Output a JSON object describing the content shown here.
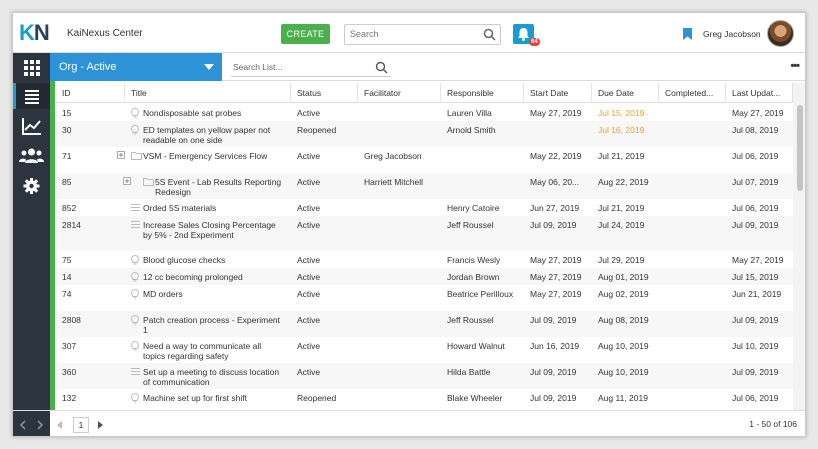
{
  "app": {
    "logo_k": "K",
    "logo_n": "N",
    "title": "KaiNexus Center"
  },
  "header": {
    "create_label": "CREATE",
    "search_placeholder": "Search",
    "notification_count": "64",
    "user_name": "Greg Jacobson"
  },
  "sidebar": {
    "items": [
      {
        "icon": "apps-grid-icon"
      },
      {
        "icon": "list-icon",
        "active": true
      },
      {
        "icon": "chart-icon"
      },
      {
        "icon": "users-icon"
      },
      {
        "icon": "gear-icon"
      }
    ]
  },
  "filter": {
    "selected": "Org - Active",
    "search_placeholder": "Search List...",
    "more_label": "•••"
  },
  "table": {
    "columns": [
      "ID",
      "Title",
      "Status",
      "Facilitator",
      "Responsible",
      "Start Date",
      "Due Date",
      "Completed...",
      "Last Updat..."
    ],
    "rows": [
      {
        "id": "15",
        "icon": "bulb",
        "title": "Nondisposable sat probes",
        "status": "Active",
        "facilitator": "",
        "responsible": "Lauren Villa",
        "start": "May 27, 2019",
        "due": "Jul 15, 2019",
        "due_overdue": true,
        "completed": "",
        "updated": "May 27, 2019"
      },
      {
        "id": "30",
        "icon": "bulb",
        "title": "ED templates on yellow paper not readable on one side",
        "status": "Reopened",
        "facilitator": "",
        "responsible": "Arnold Smith",
        "start": "",
        "due": "Jul 16, 2019",
        "due_overdue": true,
        "completed": "",
        "updated": "Jul 08, 2019"
      },
      {
        "id": "71",
        "icon": "folder",
        "expand": true,
        "title": "VSM - Emergency Services Flow",
        "status": "Active",
        "facilitator": "Greg Jacobson",
        "responsible": "",
        "start": "May 22, 2019",
        "due": "Jul 21, 2019",
        "due_overdue": false,
        "completed": "",
        "updated": "Jul 06, 2019"
      },
      {
        "id": "85",
        "icon": "folder",
        "expand": true,
        "title": "5S Event - Lab Results Reporting Redesign",
        "status": "Active",
        "facilitator": "Harriett Mitchell",
        "responsible": "",
        "start": "May 06, 20...",
        "due": "Aug 22, 2019",
        "due_overdue": false,
        "completed": "",
        "updated": "Jul 07, 2019"
      },
      {
        "id": "852",
        "icon": "list",
        "title": "Orded 5S materials",
        "status": "Active",
        "facilitator": "",
        "responsible": "Henry Catoire",
        "start": "Jun 27, 2019",
        "due": "Jul 21, 2019",
        "due_overdue": false,
        "completed": "",
        "updated": "Jul 06, 2019"
      },
      {
        "id": "2814",
        "icon": "list",
        "title": "Increase Sales Closing Percentage by 5% - 2nd Experiment",
        "status": "Active",
        "facilitator": "",
        "responsible": "Jeff Roussel",
        "start": "Jul 09, 2019",
        "due": "Jul 24, 2019",
        "due_overdue": false,
        "completed": "",
        "updated": "Jul 09, 2019"
      },
      {
        "id": "75",
        "icon": "bulb",
        "title": "Blood glucose checks",
        "status": "Active",
        "facilitator": "",
        "responsible": "Francis Wesly",
        "start": "May 27, 2019",
        "due": "Jul 29, 2019",
        "due_overdue": false,
        "completed": "",
        "updated": "May 27, 2019"
      },
      {
        "id": "14",
        "icon": "bulb",
        "title": "12 cc becoming prolonged",
        "status": "Active",
        "facilitator": "",
        "responsible": "Jordan Brown",
        "start": "May 27, 2019",
        "due": "Aug 01, 2019",
        "due_overdue": false,
        "completed": "",
        "updated": "Jul 15, 2019"
      },
      {
        "id": "74",
        "icon": "bulb",
        "title": "MD orders",
        "status": "Active",
        "facilitator": "",
        "responsible": "Beatrice Perilloux",
        "start": "May 27, 2019",
        "due": "Aug 02, 2019",
        "due_overdue": false,
        "completed": "",
        "updated": "Jun 21, 2019"
      },
      {
        "id": "2808",
        "icon": "bulb",
        "title": "Patch creation process - Experiment 1",
        "status": "Active",
        "facilitator": "",
        "responsible": "Jeff Roussel",
        "start": "Jul 09, 2019",
        "due": "Aug 08, 2019",
        "due_overdue": false,
        "completed": "",
        "updated": "Jul 09, 2019"
      },
      {
        "id": "307",
        "icon": "bulb",
        "title": "Need a way to communicate all topics regarding safety",
        "status": "Active",
        "facilitator": "",
        "responsible": "Howard Walnut",
        "start": "Jun 16, 2019",
        "due": "Aug 10, 2019",
        "due_overdue": false,
        "completed": "",
        "updated": "Jul 10, 2019"
      },
      {
        "id": "360",
        "icon": "list",
        "title": "Set up a meeting to discuss location of communication",
        "status": "Active",
        "facilitator": "",
        "responsible": "Hilda Battle",
        "start": "Jul 09, 2019",
        "due": "Aug 10, 2019",
        "due_overdue": false,
        "completed": "",
        "updated": "Jul 09, 2019"
      },
      {
        "id": "132",
        "icon": "bulb",
        "title": "Machine set up for first shift",
        "status": "Reopened",
        "facilitator": "",
        "responsible": "Blake Wheeler",
        "start": "Jul 09, 2019",
        "due": "Aug 11, 2019",
        "due_overdue": false,
        "completed": "",
        "updated": "Jul 06, 2019"
      }
    ]
  },
  "footer": {
    "page": "1",
    "range_label": "1 - 50 of 106"
  },
  "colors": {
    "accent": "#2d93d6",
    "create": "#4cae4c",
    "overdue": "#f0a030",
    "sidebar": "#2c3440"
  }
}
